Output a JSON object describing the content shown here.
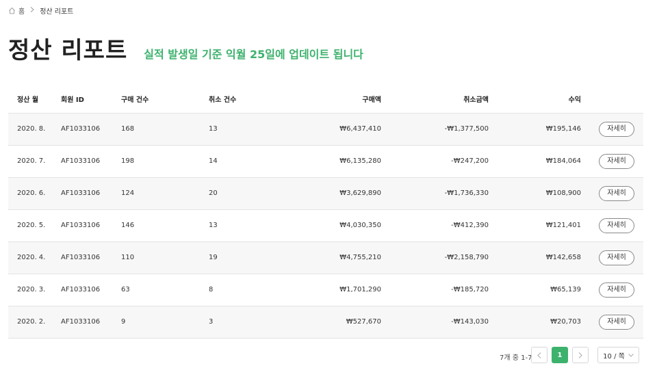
{
  "breadcrumb": {
    "icon": "home-icon",
    "home_label": "홈",
    "separator_icon": "chevron-right-icon",
    "current_label": "정산 리포트"
  },
  "header": {
    "title": "정산 리포트",
    "subtitle": "실적 발생일 기준 익월 25일에 업데이트 됩니다",
    "subtitle_color": "#3db26d"
  },
  "table": {
    "columns": {
      "month": "정산 월",
      "member_id": "회원 ID",
      "purchase_count": "구매 건수",
      "cancel_count": "취소 건수",
      "purchase_amount": "구매액",
      "cancel_amount": "취소금액",
      "revenue": "수익"
    },
    "rows": [
      {
        "month": "2020. 8.",
        "member_id": "AF1033106",
        "purchase_count": "168",
        "cancel_count": "13",
        "purchase_amount": "₩6,437,410",
        "cancel_amount": "-₩1,377,500",
        "revenue": "₩195,146",
        "action": "자세히"
      },
      {
        "month": "2020. 7.",
        "member_id": "AF1033106",
        "purchase_count": "198",
        "cancel_count": "14",
        "purchase_amount": "₩6,135,280",
        "cancel_amount": "-₩247,200",
        "revenue": "₩184,064",
        "action": "자세히"
      },
      {
        "month": "2020. 6.",
        "member_id": "AF1033106",
        "purchase_count": "124",
        "cancel_count": "20",
        "purchase_amount": "₩3,629,890",
        "cancel_amount": "-₩1,736,330",
        "revenue": "₩108,900",
        "action": "자세히"
      },
      {
        "month": "2020. 5.",
        "member_id": "AF1033106",
        "purchase_count": "146",
        "cancel_count": "13",
        "purchase_amount": "₩4,030,350",
        "cancel_amount": "-₩412,390",
        "revenue": "₩121,401",
        "action": "자세히"
      },
      {
        "month": "2020. 4.",
        "member_id": "AF1033106",
        "purchase_count": "110",
        "cancel_count": "19",
        "purchase_amount": "₩4,755,210",
        "cancel_amount": "-₩2,158,790",
        "revenue": "₩142,658",
        "action": "자세히"
      },
      {
        "month": "2020. 3.",
        "member_id": "AF1033106",
        "purchase_count": "63",
        "cancel_count": "8",
        "purchase_amount": "₩1,701,290",
        "cancel_amount": "-₩185,720",
        "revenue": "₩65,139",
        "action": "자세히"
      },
      {
        "month": "2020. 2.",
        "member_id": "AF1033106",
        "purchase_count": "9",
        "cancel_count": "3",
        "purchase_amount": "₩527,670",
        "cancel_amount": "-₩143,030",
        "revenue": "₩20,703",
        "action": "자세히"
      }
    ]
  },
  "pagination": {
    "info": "7개 중 1-7",
    "current_page": "1",
    "prev_icon": "chevron-left-icon",
    "next_icon": "chevron-right-icon",
    "page_size": "10 / 쪽",
    "page_size_icon": "chevron-down-icon",
    "accent_color": "#3db26d"
  }
}
